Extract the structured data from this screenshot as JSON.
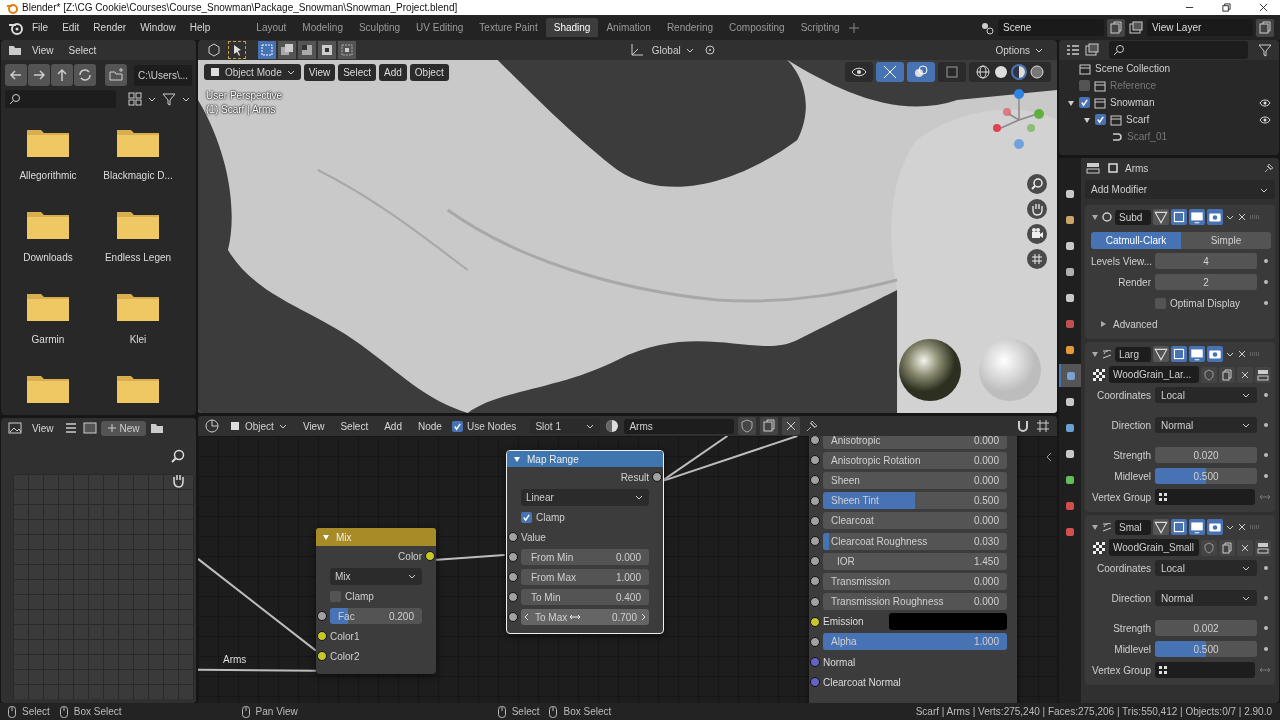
{
  "window": {
    "title": "Blender* [Z:\\CG Cookie\\Courses\\Course_Snowman\\Package_Snowman\\Snowman_Project.blend]"
  },
  "menu": [
    "File",
    "Edit",
    "Render",
    "Window",
    "Help"
  ],
  "workspaces": [
    {
      "label": "Layout",
      "selected": false
    },
    {
      "label": "Modeling",
      "selected": false
    },
    {
      "label": "Sculpting",
      "selected": false
    },
    {
      "label": "UV Editing",
      "selected": false
    },
    {
      "label": "Texture Paint",
      "selected": false
    },
    {
      "label": "Shading",
      "selected": true
    },
    {
      "label": "Animation",
      "selected": false
    },
    {
      "label": "Rendering",
      "selected": false
    },
    {
      "label": "Compositing",
      "selected": false
    },
    {
      "label": "Scripting",
      "selected": false
    }
  ],
  "scene": {
    "name": "Scene"
  },
  "view_layer": {
    "name": "View Layer"
  },
  "file_browser": {
    "menus": [
      "View",
      "Select"
    ],
    "path": "C:\\Users\\...",
    "folders": [
      {
        "kind": "named",
        "label": "Allegorithmic"
      },
      {
        "kind": "named",
        "label": "Blackmagic D..."
      },
      {
        "kind": "named",
        "label": "Downloads"
      },
      {
        "kind": "named",
        "label": "Endless Legen"
      },
      {
        "kind": "named",
        "label": "Garmin"
      },
      {
        "kind": "named",
        "label": "Klei"
      },
      {
        "kind": "cut"
      },
      {
        "kind": "cut"
      }
    ]
  },
  "viewport": {
    "mode": "Object Mode",
    "menus": [
      "View",
      "Select",
      "Add",
      "Object"
    ],
    "orientation": "Global",
    "options": "Options",
    "info": [
      "User Perspective",
      "(1) Scarf | Arms"
    ]
  },
  "image_editor": {
    "menus": [
      "View"
    ],
    "new_button": "New"
  },
  "node_editor": {
    "object": "Object",
    "menus": [
      "View",
      "Select",
      "Add",
      "Node"
    ],
    "use_nodes": {
      "label": "Use Nodes",
      "checked": true
    },
    "slot": "Slot 1",
    "material": "Arms",
    "link_label": "Arms",
    "mix_node": {
      "title": "Mix",
      "output": "Color",
      "blend": "Mix",
      "clamp": {
        "label": "Clamp",
        "checked": false
      },
      "fac": {
        "label": "Fac",
        "value": "0.200",
        "level": 0.2
      },
      "inputs": [
        "Color1",
        "Color2"
      ]
    },
    "map_range_node": {
      "title": "Map Range",
      "output": "Result",
      "interpolation": "Linear",
      "clamp": {
        "label": "Clamp",
        "checked": true
      },
      "input": "Value",
      "fields": [
        {
          "label": "From Min",
          "value": "0.000",
          "hovered": false
        },
        {
          "label": "From Max",
          "value": "1.000",
          "hovered": false
        },
        {
          "label": "To Min",
          "value": "0.400",
          "hovered": false
        },
        {
          "label": "To Max",
          "value": "0.700",
          "hovered": true
        }
      ]
    },
    "bsdf_inputs": [
      {
        "kind": "slider",
        "label": "Anisotropic",
        "value": "0.000",
        "level": 0,
        "color": "#a1a1a1"
      },
      {
        "kind": "slider",
        "label": "Anisotropic Rotation",
        "value": "0.000",
        "level": 0,
        "color": "#a1a1a1"
      },
      {
        "kind": "slider",
        "label": "Sheen",
        "value": "0.000",
        "level": 0,
        "color": "#a1a1a1"
      },
      {
        "kind": "slider",
        "label": "Sheen Tint",
        "value": "0.500",
        "level": 0.5,
        "color": "#a1a1a1"
      },
      {
        "kind": "slider",
        "label": "Clearcoat",
        "value": "0.000",
        "level": 0,
        "color": "#a1a1a1"
      },
      {
        "kind": "slider",
        "label": "Clearcoat Roughness",
        "value": "0.030",
        "level": 0.03,
        "color": "#a1a1a1"
      },
      {
        "kind": "number",
        "label": "IOR",
        "value": "1.450",
        "color": "#a1a1a1"
      },
      {
        "kind": "slider",
        "label": "Transmission",
        "value": "0.000",
        "level": 0,
        "color": "#a1a1a1"
      },
      {
        "kind": "slider",
        "label": "Transmission Roughness",
        "value": "0.000",
        "level": 0,
        "color": "#a1a1a1"
      },
      {
        "kind": "color",
        "label": "Emission",
        "color": "#c7c729"
      },
      {
        "kind": "slider",
        "label": "Alpha",
        "value": "1.000",
        "level": 1,
        "color": "#a1a1a1"
      },
      {
        "kind": "vector",
        "label": "Normal",
        "color": "#6363c7"
      },
      {
        "kind": "vector",
        "label": "Clearcoat Normal",
        "color": "#6363c7"
      }
    ]
  },
  "outliner": {
    "root": "Scene Collection",
    "tree": [
      {
        "kind": "collection",
        "label": "Reference",
        "checked": false
      },
      {
        "kind": "collection",
        "label": "Snowman",
        "checked": true,
        "expanded": true,
        "children": [
          {
            "kind": "collection",
            "label": "Scarf",
            "checked": true,
            "expanded": true,
            "children": [
              {
                "kind": "object",
                "label": "Scarf_01"
              }
            ]
          }
        ]
      }
    ]
  },
  "property_tabs": [
    {
      "selected": false
    },
    {
      "selected": false
    },
    {
      "selected": false
    },
    {
      "selected": false
    },
    {
      "selected": false
    },
    {
      "selected": false
    },
    {
      "selected": false
    },
    {
      "selected": true
    },
    {
      "selected": false
    },
    {
      "selected": false
    },
    {
      "selected": false
    },
    {
      "selected": false
    },
    {
      "selected": false
    },
    {
      "selected": false
    }
  ],
  "properties": {
    "object": "Arms",
    "add_modifier": "Add Modifier",
    "modifiers": [
      {
        "kind": "subdivision",
        "name": "Subd",
        "methods": [
          {
            "label": "Catmull-Clark",
            "selected": true
          },
          {
            "label": "Simple",
            "selected": false
          }
        ],
        "fields": [
          {
            "label": "Levels View...",
            "value": "4"
          },
          {
            "label": "Render",
            "value": "2"
          }
        ],
        "optimal_display": {
          "label": "Optimal Display",
          "checked": false
        },
        "advanced": {
          "label": "Advanced",
          "expanded": false
        }
      },
      {
        "kind": "displace",
        "name": "Larg",
        "texture": "WoodGrain_Lar...",
        "coordinates": {
          "label": "Coordinates",
          "value": "Local"
        },
        "direction": {
          "label": "Direction",
          "value": "Normal"
        },
        "strength": {
          "label": "Strength",
          "value": "0.020"
        },
        "midlevel": {
          "label": "Midlevel",
          "value": "0.500",
          "level": 0.5
        },
        "vertex_group": "Vertex Group"
      },
      {
        "kind": "displace",
        "name": "Smal",
        "texture": "WoodGrain_Small",
        "coordinates": {
          "label": "Coordinates",
          "value": "Local"
        },
        "direction": {
          "label": "Direction",
          "value": "Normal"
        },
        "strength": {
          "label": "Strength",
          "value": "0.002"
        },
        "midlevel": {
          "label": "Midlevel",
          "value": "0.500",
          "level": 0.5
        },
        "vertex_group": "Vertex Group"
      }
    ]
  },
  "status_bar": {
    "left": [
      "Select",
      "Box Select",
      "Pan View"
    ],
    "center": [
      "Select",
      "Box Select"
    ],
    "stats": "Scarf | Arms | Verts:275,240 | Faces:275,206 | Tris:550,412 | Objects:0/7 | 2.90.0"
  }
}
